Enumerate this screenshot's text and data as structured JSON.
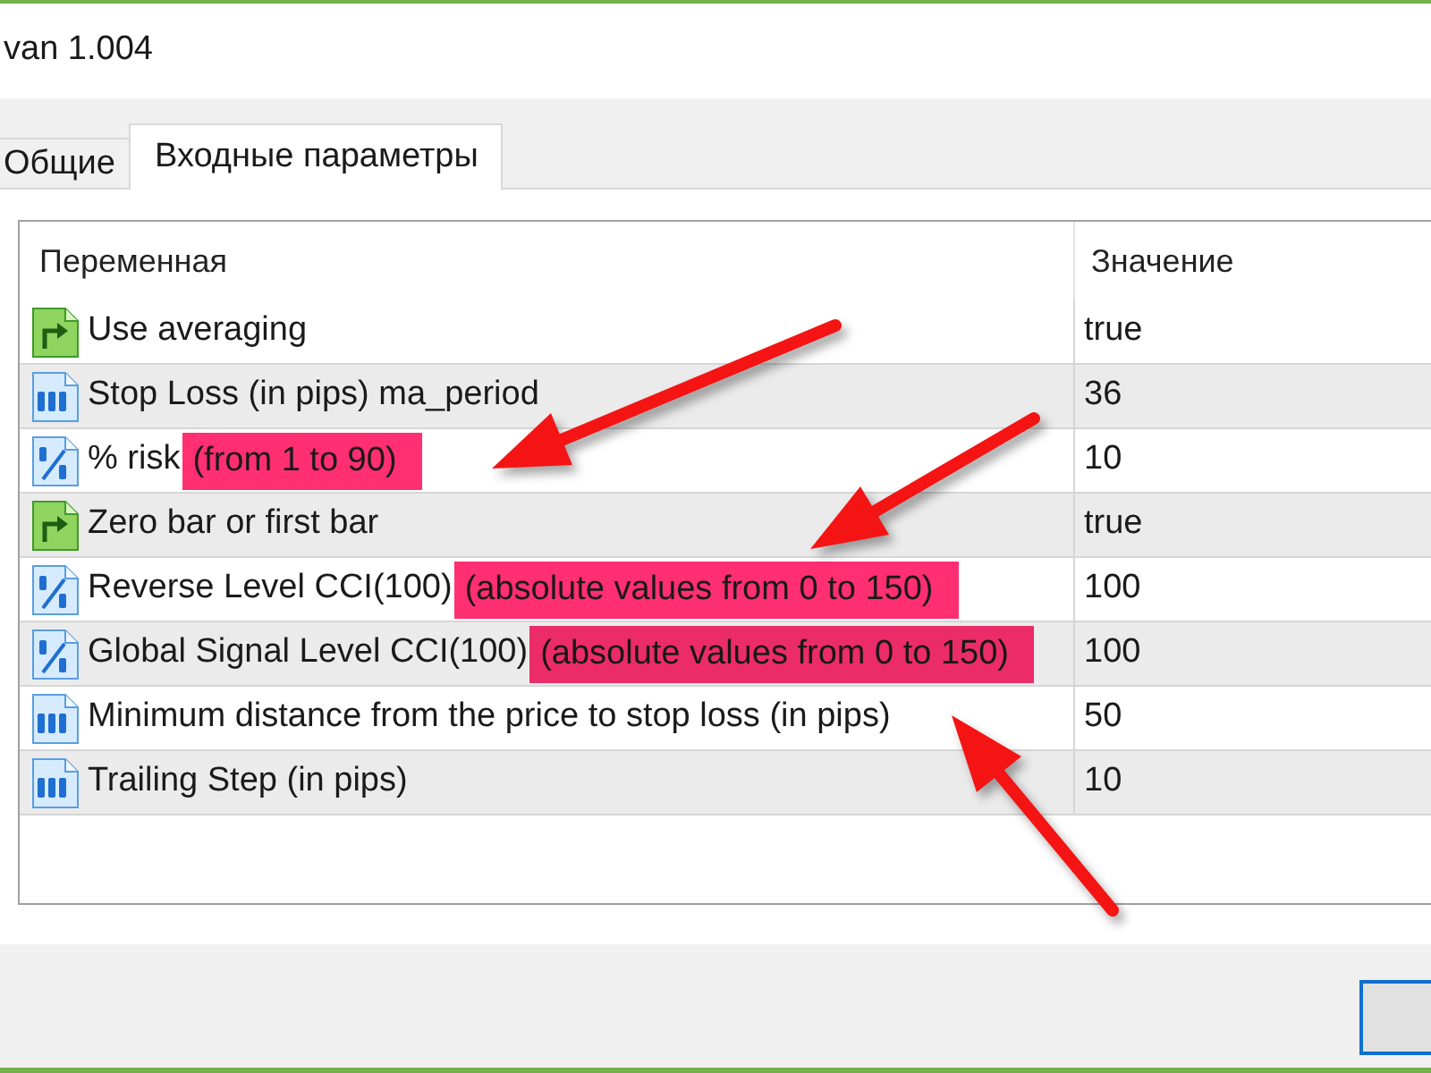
{
  "window": {
    "title": "van 1.004"
  },
  "tabs": [
    {
      "label": "Общие",
      "selected": false
    },
    {
      "label": "Входные параметры",
      "selected": true
    }
  ],
  "table": {
    "columns": [
      "Переменная",
      "Значение"
    ],
    "rows": [
      {
        "kind": "bool",
        "name": [
          {
            "text": "Use averaging",
            "highlighted": false
          }
        ],
        "value": "true"
      },
      {
        "kind": "int",
        "name": [
          {
            "text": "Stop Loss (in pips) ma_period",
            "highlighted": false
          }
        ],
        "value": "36"
      },
      {
        "kind": "double",
        "name": [
          {
            "text": "% risk",
            "highlighted": false
          },
          {
            "text": "(from 1 to 90)",
            "highlighted": true
          }
        ],
        "value": "10"
      },
      {
        "kind": "bool",
        "name": [
          {
            "text": "Zero bar or first bar",
            "highlighted": false
          }
        ],
        "value": "true"
      },
      {
        "kind": "double",
        "name": [
          {
            "text": "Reverse Level CCI(100)",
            "highlighted": false
          },
          {
            "text": "(absolute values from 0 to 150)",
            "highlighted": true
          }
        ],
        "value": "100"
      },
      {
        "kind": "double",
        "name": [
          {
            "text": "Global Signal Level CCI(100)",
            "highlighted": false
          },
          {
            "text": "(absolute values from 0 to 150)",
            "highlighted": true
          }
        ],
        "value": "100"
      },
      {
        "kind": "int",
        "name": [
          {
            "text": "Minimum distance from the price to stop loss (in pips)",
            "highlighted": false
          }
        ],
        "value": "50"
      },
      {
        "kind": "int",
        "name": [
          {
            "text": "Trailing Step (in pips)",
            "highlighted": false
          }
        ],
        "value": "10"
      }
    ]
  }
}
